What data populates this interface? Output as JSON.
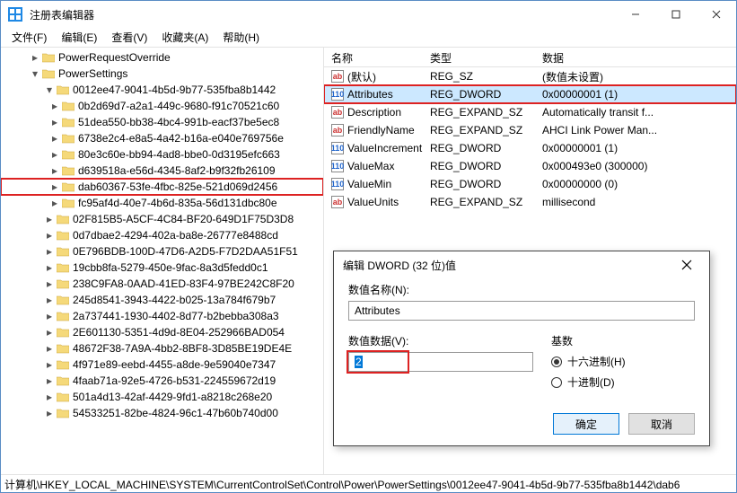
{
  "window": {
    "title": "注册表编辑器"
  },
  "menubar": [
    "文件(F)",
    "编辑(E)",
    "查看(V)",
    "收藏夹(A)",
    "帮助(H)"
  ],
  "tree": {
    "top_items": [
      {
        "label": "PowerRequestOverride",
        "indent": 2,
        "exp": "right"
      },
      {
        "label": "PowerSettings",
        "indent": 2,
        "exp": "down"
      },
      {
        "label": "0012ee47-9041-4b5d-9b77-535fba8b1442",
        "indent": 3,
        "exp": "down"
      }
    ],
    "guid_items": [
      {
        "label": "0b2d69d7-a2a1-449c-9680-f91c70521c60",
        "exp": "right"
      },
      {
        "label": "51dea550-bb38-4bc4-991b-eacf37be5ec8",
        "exp": "right"
      },
      {
        "label": "6738e2c4-e8a5-4a42-b16a-e040e769756e",
        "exp": "right"
      },
      {
        "label": "80e3c60e-bb94-4ad8-bbe0-0d3195efc663",
        "exp": "right"
      },
      {
        "label": "d639518a-e56d-4345-8af2-b9f32fb26109",
        "exp": "right"
      },
      {
        "label": "dab60367-53fe-4fbc-825e-521d069d2456",
        "exp": "right",
        "highlight": true
      },
      {
        "label": "fc95af4d-40e7-4b6d-835a-56d131dbc80e",
        "exp": "right"
      }
    ],
    "bottom_items": [
      "02F815B5-A5CF-4C84-BF20-649D1F75D3D8",
      "0d7dbae2-4294-402a-ba8e-26777e8488cd",
      "0E796BDB-100D-47D6-A2D5-F7D2DAA51F51",
      "19cbb8fa-5279-450e-9fac-8a3d5fedd0c1",
      "238C9FA8-0AAD-41ED-83F4-97BE242C8F20",
      "245d8541-3943-4422-b025-13a784f679b7",
      "2a737441-1930-4402-8d77-b2bebba308a3",
      "2E601130-5351-4d9d-8E04-252966BAD054",
      "48672F38-7A9A-4bb2-8BF8-3D85BE19DE4E",
      "4f971e89-eebd-4455-a8de-9e59040e7347",
      "4faab71a-92e5-4726-b531-224559672d19",
      "501a4d13-42af-4429-9fd1-a8218c268e20",
      "54533251-82be-4824-96c1-47b60b740d00"
    ]
  },
  "list": {
    "headers": {
      "name": "名称",
      "type": "类型",
      "data": "数据"
    },
    "rows": [
      {
        "name": "(默认)",
        "type": "REG_SZ",
        "data": "(数值未设置)",
        "icon": "str"
      },
      {
        "name": "Attributes",
        "type": "REG_DWORD",
        "data": "0x00000001 (1)",
        "icon": "bin",
        "highlight": true,
        "selected": true
      },
      {
        "name": "Description",
        "type": "REG_EXPAND_SZ",
        "data": "Automatically transit f...",
        "icon": "str"
      },
      {
        "name": "FriendlyName",
        "type": "REG_EXPAND_SZ",
        "data": "AHCI Link Power Man...",
        "icon": "str"
      },
      {
        "name": "ValueIncrement",
        "type": "REG_DWORD",
        "data": "0x00000001 (1)",
        "icon": "bin"
      },
      {
        "name": "ValueMax",
        "type": "REG_DWORD",
        "data": "0x000493e0 (300000)",
        "icon": "bin"
      },
      {
        "name": "ValueMin",
        "type": "REG_DWORD",
        "data": "0x00000000 (0)",
        "icon": "bin"
      },
      {
        "name": "ValueUnits",
        "type": "REG_EXPAND_SZ",
        "data": "millisecond",
        "icon": "str"
      }
    ]
  },
  "dialog": {
    "title": "编辑 DWORD (32 位)值",
    "name_label": "数值名称(N):",
    "name_value": "Attributes",
    "data_label": "数值数据(V):",
    "data_value": "2",
    "base_label": "基数",
    "radio_hex": "十六进制(H)",
    "radio_dec": "十进制(D)",
    "ok": "确定",
    "cancel": "取消"
  },
  "statusbar": "计算机\\HKEY_LOCAL_MACHINE\\SYSTEM\\CurrentControlSet\\Control\\Power\\PowerSettings\\0012ee47-9041-4b5d-9b77-535fba8b1442\\dab6"
}
